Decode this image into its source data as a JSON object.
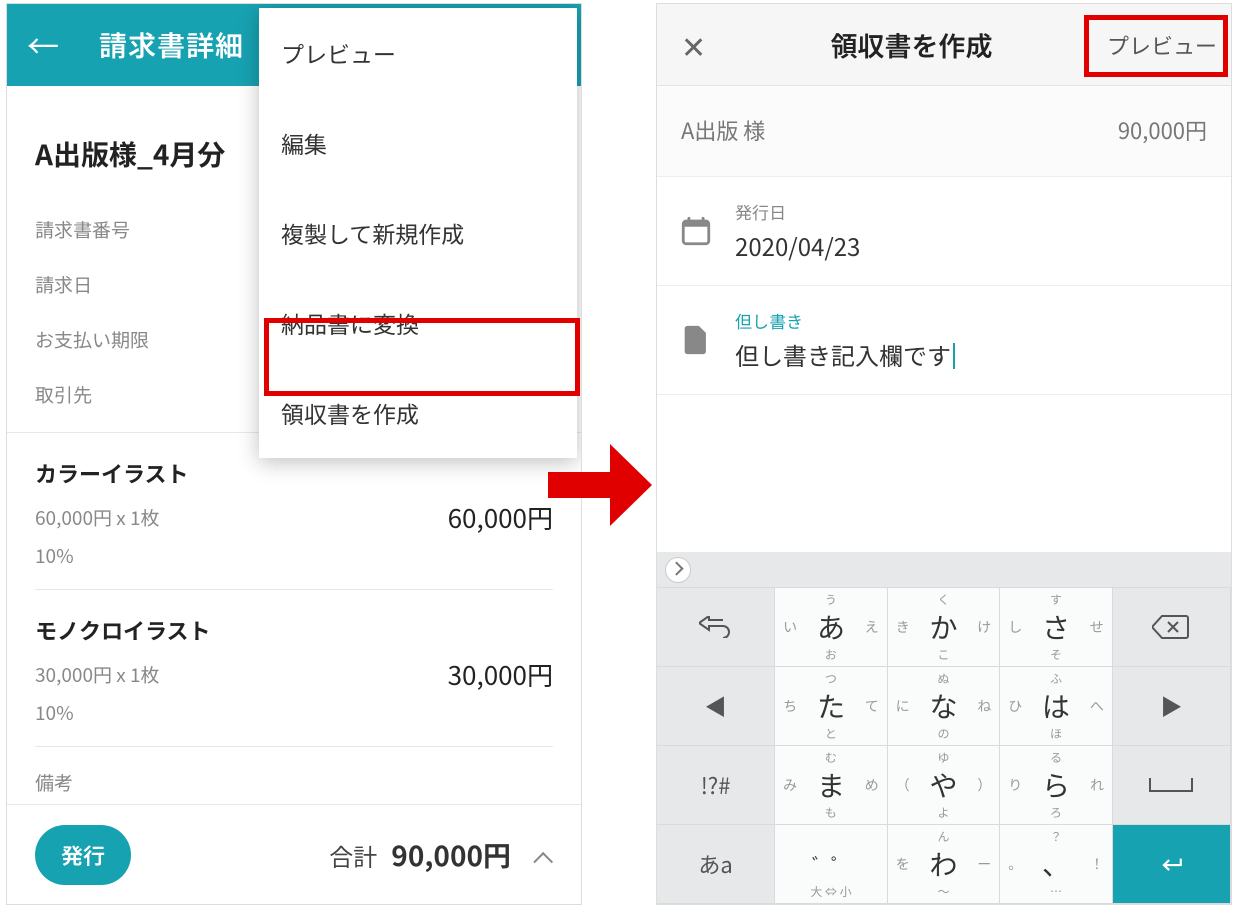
{
  "left": {
    "header": {
      "title": "請求書詳細"
    },
    "doc_title": "A出版様_4月分",
    "meta": {
      "invoice_no_label": "請求書番号",
      "invoice_date_label": "請求日",
      "due_label": "お支払い期限",
      "client_label": "取引先"
    },
    "items": [
      {
        "name": "カラーイラスト",
        "sub": "60,000円 x 1枚",
        "amount": "60,000円",
        "tax": "10%"
      },
      {
        "name": "モノクロイラスト",
        "sub": "30,000円 x 1枚",
        "amount": "30,000円",
        "tax": "10%"
      }
    ],
    "remarks_label": "備考",
    "footer": {
      "issue": "発行",
      "total_label": "合計",
      "total_value": "90,000円"
    },
    "menu": {
      "preview": "プレビュー",
      "edit": "編集",
      "duplicate": "複製して新規作成",
      "convert": "納品書に変換",
      "receipt": "領収書を作成"
    }
  },
  "right": {
    "header": {
      "title": "領収書を作成",
      "preview": "プレビュー"
    },
    "summary": {
      "client": "A出版 様",
      "amount": "90,000円"
    },
    "issue_date": {
      "label": "発行日",
      "value": "2020/04/23"
    },
    "note": {
      "label": "但し書き",
      "value": "但し書き記入欄です"
    }
  },
  "keyboard": {
    "rows": [
      [
        {
          "type": "gray",
          "icon": "undo"
        },
        {
          "c": "あ",
          "t": "う",
          "b": "お",
          "l": "い",
          "r": "え"
        },
        {
          "c": "か",
          "t": "く",
          "b": "こ",
          "l": "き",
          "r": "け"
        },
        {
          "c": "さ",
          "t": "す",
          "b": "そ",
          "l": "し",
          "r": "せ"
        },
        {
          "type": "gray",
          "icon": "bksp"
        }
      ],
      [
        {
          "type": "gray",
          "icon": "left"
        },
        {
          "c": "た",
          "t": "つ",
          "b": "と",
          "l": "ち",
          "r": "て"
        },
        {
          "c": "な",
          "t": "ぬ",
          "b": "の",
          "l": "に",
          "r": "ね"
        },
        {
          "c": "は",
          "t": "ふ",
          "b": "ほ",
          "l": "ひ",
          "r": "へ"
        },
        {
          "type": "gray",
          "icon": "right"
        }
      ],
      [
        {
          "type": "gray",
          "text": "!?#"
        },
        {
          "c": "ま",
          "t": "む",
          "b": "も",
          "l": "み",
          "r": "め"
        },
        {
          "c": "や",
          "t": "ゆ",
          "b": "よ",
          "l": "（",
          "r": "）"
        },
        {
          "c": "ら",
          "t": "る",
          "b": "ろ",
          "l": "り",
          "r": "れ"
        },
        {
          "type": "gray",
          "icon": "space"
        }
      ],
      [
        {
          "type": "gray",
          "text": "あa"
        },
        {
          "c": "゛゜",
          "b": "大 ⇔ 小",
          "subsmall": true
        },
        {
          "c": "わ",
          "t": "ん",
          "b": "〜",
          "l": "を",
          "r": "ー"
        },
        {
          "c": "、",
          "t": "？",
          "b": "…",
          "l": "。",
          "r": "！"
        },
        {
          "type": "enter",
          "icon": "enter"
        }
      ]
    ]
  }
}
